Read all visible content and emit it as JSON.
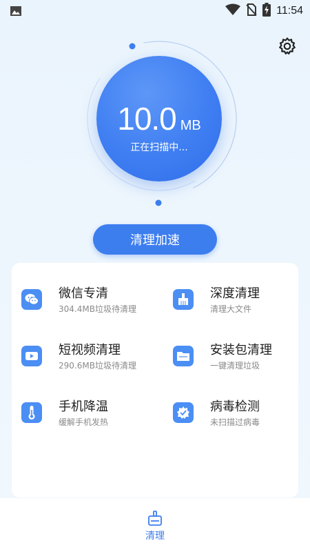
{
  "status_bar": {
    "time": "11:54"
  },
  "scan": {
    "value": "10.0",
    "unit": "MB",
    "status": "正在扫描中..."
  },
  "accelerate_button": "清理加速",
  "features": [
    {
      "title": "微信专清",
      "subtitle": "304.4MB垃圾待清理",
      "icon": "wechat-icon"
    },
    {
      "title": "深度清理",
      "subtitle": "清理大文件",
      "icon": "broom-icon"
    },
    {
      "title": "短视频清理",
      "subtitle": "290.6MB垃圾待清理",
      "icon": "video-icon"
    },
    {
      "title": "安装包清理",
      "subtitle": "一键清理垃圾",
      "icon": "folder-icon"
    },
    {
      "title": "手机降温",
      "subtitle": "缓解手机发热",
      "icon": "thermometer-icon"
    },
    {
      "title": "病毒检测",
      "subtitle": "未扫描过病毒",
      "icon": "virus-shield-icon"
    }
  ],
  "bottom_nav": {
    "label": "清理",
    "icon": "broom-icon"
  },
  "colors": {
    "accent": "#3d7eef",
    "icon_bg": "#4b8ef4",
    "background": "#eaf4fd"
  }
}
